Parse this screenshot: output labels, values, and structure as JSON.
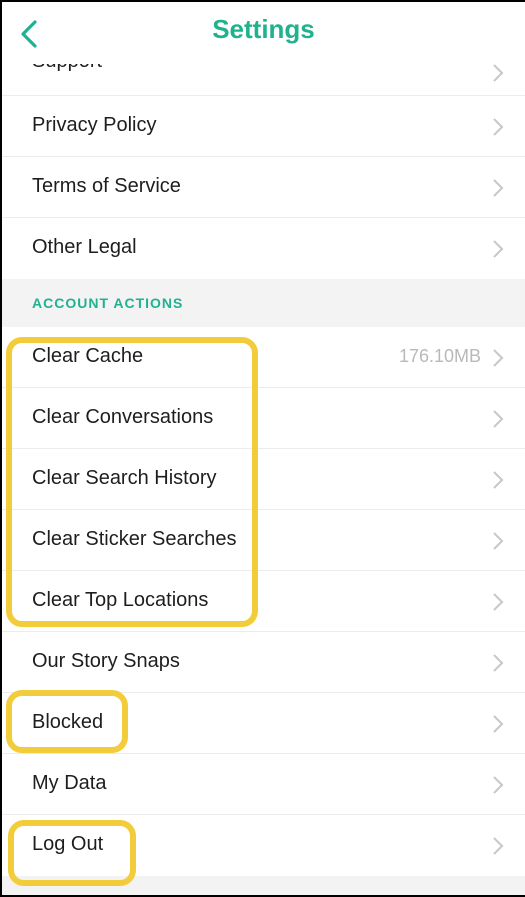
{
  "header": {
    "title": "Settings",
    "back_icon": "chevron-left-icon"
  },
  "colors": {
    "accent": "#20b28f",
    "highlight": "#f2cc3a",
    "section_bg": "#f3f3f3",
    "chevron": "#c7c7cc"
  },
  "rows_top": [
    {
      "label": "Support"
    },
    {
      "label": "Privacy Policy"
    },
    {
      "label": "Terms of Service"
    },
    {
      "label": "Other Legal"
    }
  ],
  "section": {
    "label": "ACCOUNT ACTIONS"
  },
  "rows_account": [
    {
      "label": "Clear Cache",
      "value": "176.10MB"
    },
    {
      "label": "Clear Conversations"
    },
    {
      "label": "Clear Search History"
    },
    {
      "label": "Clear Sticker Searches"
    },
    {
      "label": "Clear Top Locations"
    },
    {
      "label": "Our Story Snaps"
    },
    {
      "label": "Blocked"
    },
    {
      "label": "My Data"
    },
    {
      "label": "Log Out"
    }
  ]
}
